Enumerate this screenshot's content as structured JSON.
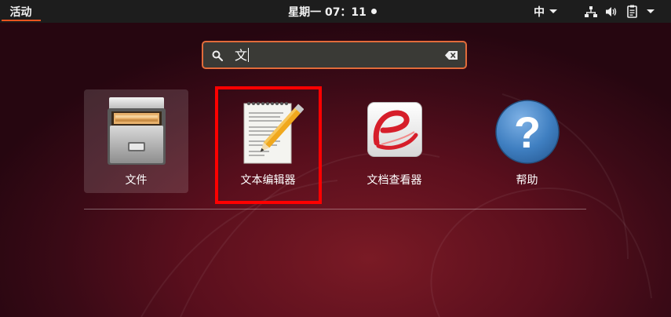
{
  "topbar": {
    "activities_label": "活动",
    "clock": "星期一 07：11",
    "ime_label": "中",
    "icons": [
      "network-icon",
      "volume-icon",
      "clipboard-icon",
      "system-menu-arrow-icon"
    ]
  },
  "search": {
    "value": "文",
    "icon": "search-icon",
    "clear_icon": "clear-icon"
  },
  "apps": [
    {
      "label": "文件",
      "icon": "file-cabinet-icon",
      "selected": true
    },
    {
      "label": "文本编辑器",
      "icon": "text-editor-icon",
      "selected": false
    },
    {
      "label": "文档查看器",
      "icon": "document-viewer-icon",
      "selected": false
    },
    {
      "label": "帮助",
      "icon": "help-icon",
      "selected": false
    }
  ],
  "colors": {
    "accent": "#e95420",
    "highlight_box": "#ff0000",
    "topbar_bg": "#1d1d1d",
    "background": "#5a0f1d"
  }
}
